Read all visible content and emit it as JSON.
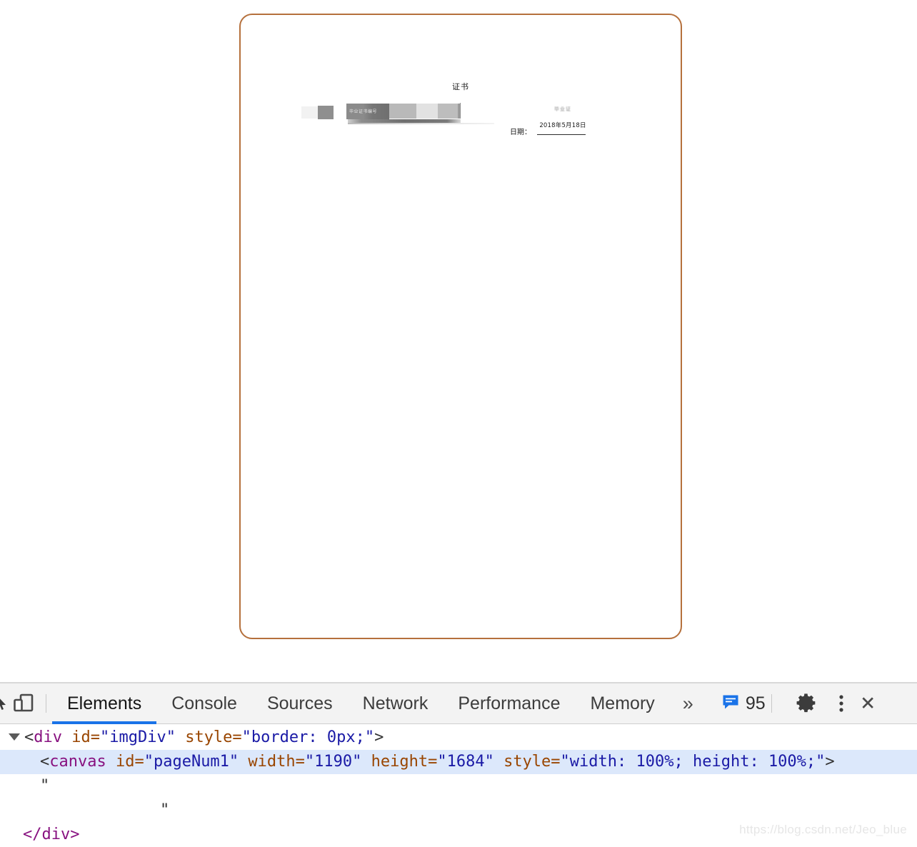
{
  "document_preview": {
    "title": "证书",
    "redacted_label": "毕业证书编号",
    "faint_note": "毕业证",
    "date_label": "日期：",
    "date_value": "2018年5月18日",
    "card_border_color": "#b5703c"
  },
  "devtools": {
    "icons": {
      "inspect": "inspect-element-icon",
      "device": "device-toolbar-icon",
      "issues": "issues-message-icon",
      "settings": "gear-icon",
      "more_options": "kebab-menu-icon",
      "close": "close-icon",
      "more_tabs": "»"
    },
    "tabs": [
      {
        "label": "Elements",
        "active": true
      },
      {
        "label": "Console",
        "active": false
      },
      {
        "label": "Sources",
        "active": false
      },
      {
        "label": "Network",
        "active": false
      },
      {
        "label": "Performance",
        "active": false
      },
      {
        "label": "Memory",
        "active": false
      }
    ],
    "more_tabs_label": "»",
    "issues_count": "95",
    "accent_color": "#1a73e8",
    "elements_tree": {
      "row_div": {
        "open_punct": "<",
        "tag": "div",
        "attr1_name": " id=",
        "attr1_value": "\"imgDiv\"",
        "attr2_name": " style=",
        "attr2_value": "\"border: 0px;\"",
        "close_punct": ">"
      },
      "row_canvas": {
        "open_punct": "<",
        "tag": "canvas",
        "attr1_name": " id=",
        "attr1_value": "\"pageNum1\"",
        "attr2_name": " width=",
        "attr2_value": "\"1190\"",
        "attr3_name": " height=",
        "attr3_value": "\"1684\"",
        "attr4_name": " style=",
        "attr4_value": "\"width: 100%; height: 100%;\"",
        "close_punct": ">"
      },
      "row_text_1": "\"",
      "row_text_2": "\"",
      "row_close": "</div>"
    }
  },
  "watermark": "https://blog.csdn.net/Jeo_blue"
}
